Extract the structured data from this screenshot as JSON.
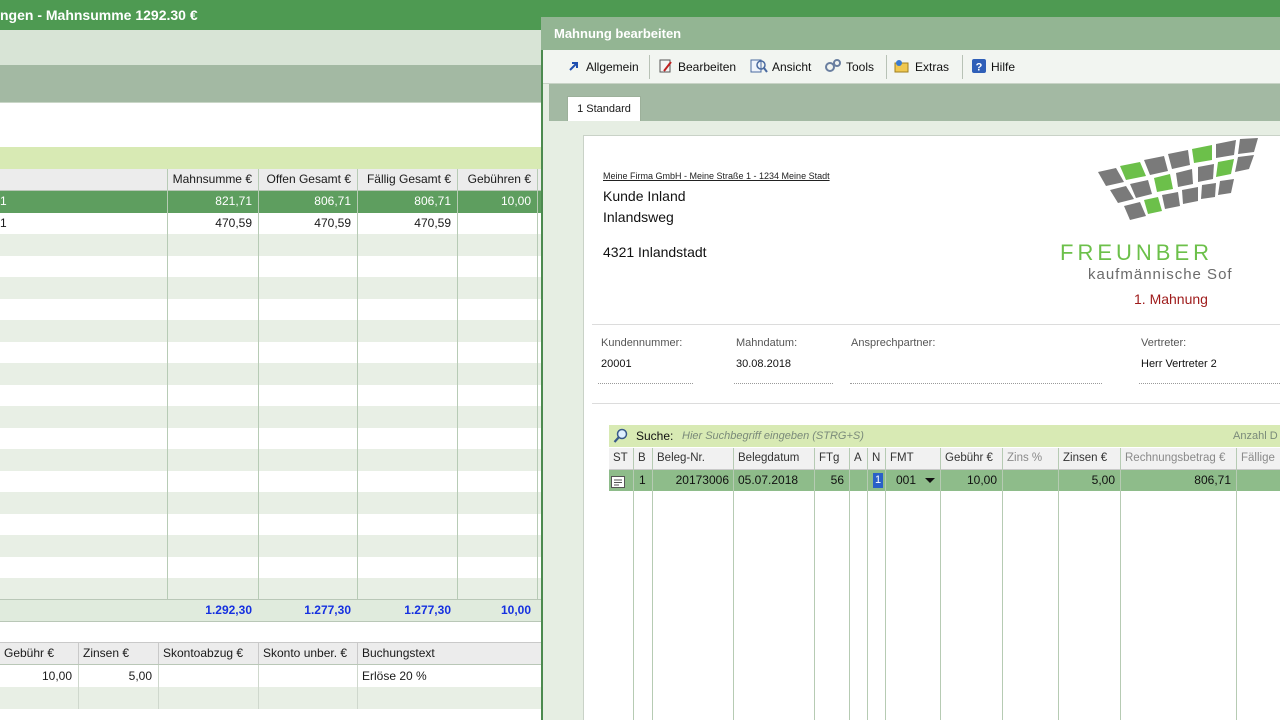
{
  "background_window": {
    "title": "ngen - Mahnsumme 1292.30 €",
    "grid": {
      "columns": [
        "Mahnsumme €",
        "Offen Gesamt €",
        "Fällig Gesamt €",
        "Gebühren €"
      ],
      "rows": [
        {
          "lead": "1",
          "mahnsumme": "821,71",
          "offen": "806,71",
          "faellig": "806,71",
          "gebuehren": "10,00",
          "selected": true
        },
        {
          "lead": "1",
          "mahnsumme": "470,59",
          "offen": "470,59",
          "faellig": "470,59",
          "gebuehren": "",
          "selected": false
        }
      ],
      "totals": {
        "mahnsumme": "1.292,30",
        "offen": "1.277,30",
        "faellig": "1.277,30",
        "gebuehren": "10,00"
      }
    },
    "sub_grid": {
      "columns": [
        "Gebühr €",
        "Zinsen €",
        "Skontoabzug €",
        "Skonto unber. €",
        "Buchungstext"
      ],
      "rows": [
        {
          "gebuehr": "10,00",
          "zinsen": "5,00",
          "skontoabzug": "",
          "skonto_unber": "",
          "buchungstext": "Erlöse 20 %"
        }
      ]
    }
  },
  "dialog": {
    "title": "Mahnung bearbeiten",
    "menu": [
      {
        "label": "Allgemein",
        "icon": "arrow-icon"
      },
      {
        "label": "Bearbeiten",
        "icon": "edit-icon"
      },
      {
        "label": "Ansicht",
        "icon": "view-icon"
      },
      {
        "label": "Tools",
        "icon": "gears-icon"
      },
      {
        "label": "Extras",
        "icon": "extras-icon"
      },
      {
        "label": "Hilfe",
        "icon": "help-icon"
      }
    ],
    "tab": "1 Standard",
    "document": {
      "sender_line": "Meine Firma GmbH - Meine Straße 1 - 1234 Meine Stadt",
      "recipient": [
        "Kunde Inland",
        "Inlandsweg",
        "4321 Inlandstadt"
      ],
      "logo_word": "FREUNBER",
      "logo_sub": "kaufmännische Sof",
      "heading": "1. Mahnung",
      "fields": {
        "kundennummer": {
          "label": "Kundennummer:",
          "value": "20001"
        },
        "mahndatum": {
          "label": "Mahndatum:",
          "value": "30.08.2018"
        },
        "ansprechpartner": {
          "label": "Ansprechpartner:",
          "value": ""
        },
        "vertreter": {
          "label": "Vertreter:",
          "value": "Herr Vertreter 2"
        }
      },
      "search": {
        "label": "Suche:",
        "placeholder": "Hier Suchbegriff eingeben (STRG+S)",
        "count_label": "Anzahl D"
      },
      "items": {
        "columns": [
          "ST",
          "B",
          "Beleg-Nr.",
          "Belegdatum",
          "FTg",
          "A",
          "N",
          "FMT",
          "Gebühr €",
          "Zins %",
          "Zinsen €",
          "Rechnungsbetrag €",
          "Fällige"
        ],
        "rows": [
          {
            "st": "",
            "b": "1",
            "beleg_nr": "20173006",
            "belegdatum": "05.07.2018",
            "ftg": "56",
            "a": "",
            "n": "1",
            "fmt": "001",
            "gebuehr": "10,00",
            "zins": "",
            "zinsen": "5,00",
            "rechnungsbetrag": "806,71",
            "faellig": ""
          }
        ]
      }
    }
  },
  "colors": {
    "title_green": "#4e9a52",
    "selection_green": "#5e9e5f",
    "filter_lime": "#d8eab4",
    "totals_blue": "#1530e0",
    "heading_red": "#9e1a1a"
  }
}
